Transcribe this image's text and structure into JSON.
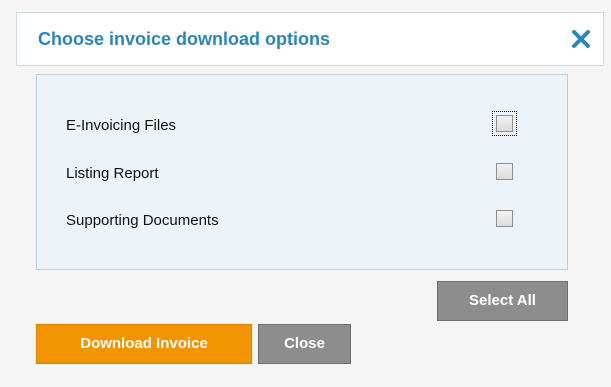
{
  "dialog": {
    "title": "Choose invoice download options",
    "close_icon": "close-x-icon",
    "accent_color": "#2a86b8"
  },
  "options": [
    {
      "label": "E-Invoicing Files",
      "checked": false,
      "focused": true
    },
    {
      "label": "Listing Report",
      "checked": false,
      "focused": false
    },
    {
      "label": "Supporting Documents",
      "checked": false,
      "focused": false
    }
  ],
  "buttons": {
    "select_all": "Select All",
    "download_invoice": "Download Invoice",
    "close": "Close"
  },
  "colors": {
    "primary_button": "#f29400",
    "secondary_button": "#8d8d8d",
    "panel_background": "#ecf3f9"
  }
}
